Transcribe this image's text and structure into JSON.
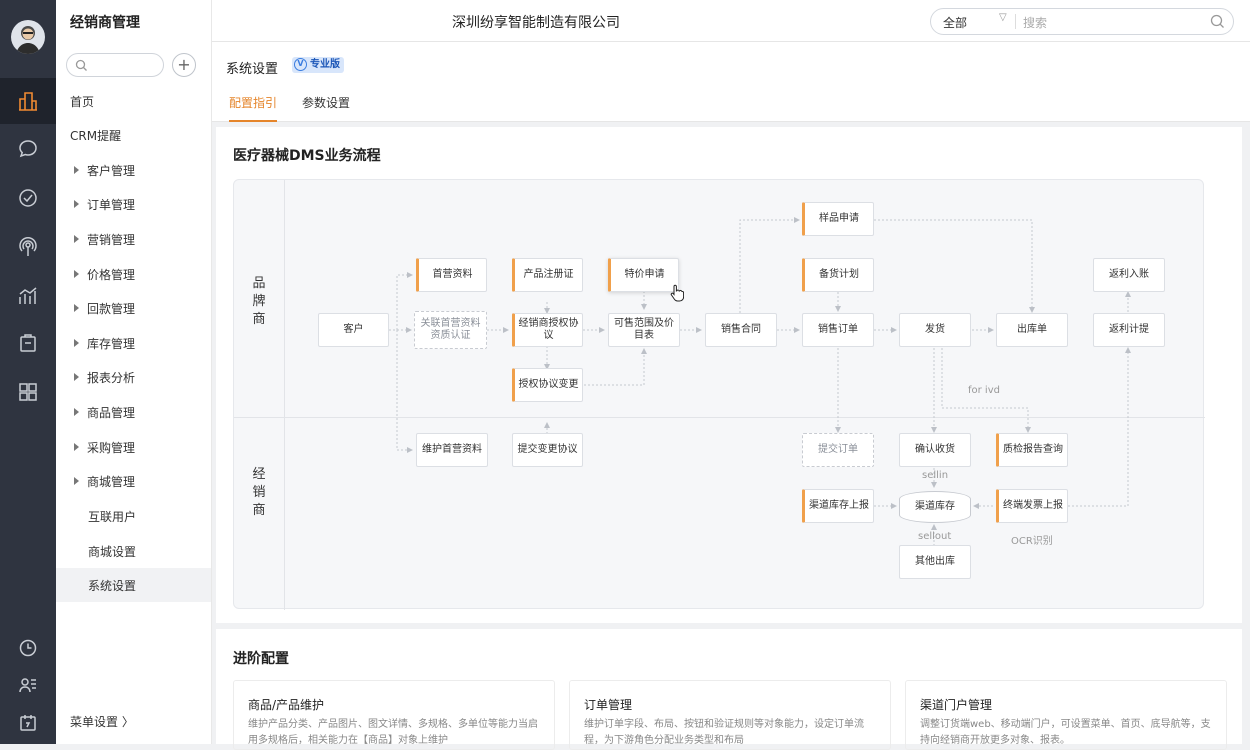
{
  "app": {
    "title": "经销商管理",
    "company": "深圳纷享智能制造有限公司"
  },
  "search": {
    "scope": "全部",
    "placeholder": "搜索"
  },
  "sidebar": {
    "items": [
      {
        "label": "首页",
        "expandable": false,
        "indent": false
      },
      {
        "label": "CRM提醒",
        "expandable": false,
        "indent": false
      },
      {
        "label": "客户管理",
        "expandable": true
      },
      {
        "label": "订单管理",
        "expandable": true
      },
      {
        "label": "营销管理",
        "expandable": true
      },
      {
        "label": "价格管理",
        "expandable": true
      },
      {
        "label": "回款管理",
        "expandable": true
      },
      {
        "label": "库存管理",
        "expandable": true
      },
      {
        "label": "报表分析",
        "expandable": true
      },
      {
        "label": "商品管理",
        "expandable": true
      },
      {
        "label": "采购管理",
        "expandable": true
      },
      {
        "label": "商城管理",
        "expandable": true
      },
      {
        "label": "互联用户",
        "expandable": false,
        "indent": true
      },
      {
        "label": "商城设置",
        "expandable": false,
        "indent": true
      },
      {
        "label": "系统设置",
        "expandable": false,
        "indent": true,
        "active": true
      }
    ],
    "footer": "菜单设置 〉"
  },
  "page": {
    "title": "系统设置",
    "badge": "专业版",
    "tabs": [
      "配置指引",
      "参数设置"
    ]
  },
  "flow": {
    "title": "医疗器械DMS业务流程",
    "lanes": [
      "品牌商",
      "经销商"
    ],
    "nodes": {
      "n_customer": "客户",
      "n_sgzl": "首营资料",
      "n_glsy": "关联首营资料资质认证",
      "n_cpzc": "产品注册证",
      "n_jxsxy": "经销商授权协议",
      "n_sqbg": "授权协议变更",
      "n_tjsq": "特价申请",
      "n_ksfw": "可售范围及价目表",
      "n_xsht": "销售合同",
      "n_ypsq": "样品申请",
      "n_bhjh": "备货计划",
      "n_xsdd": "销售订单",
      "n_fh": "发货",
      "n_ckd": "出库单",
      "n_flrz": "返利入账",
      "n_fljt": "返利计提",
      "n_whsy": "维护首营资料",
      "n_tjbg": "提交变更协议",
      "n_tjdd": "提交订单",
      "n_qrsh": "确认收货",
      "n_zjbg": "质检报告查询",
      "n_qdkcsb": "渠道库存上报",
      "n_qdkc": "渠道库存",
      "n_zdfp": "终端发票上报",
      "n_qtck": "其他出库"
    },
    "labels": {
      "forivd": "for ivd",
      "sellin": "sellin",
      "sellout": "sellout",
      "ocr": "OCR识别"
    }
  },
  "advanced": {
    "title": "进阶配置",
    "cards": [
      {
        "title": "商品/产品维护",
        "desc": "维护产品分类、产品图片、图文详情、多规格、多单位等能力当启用多规格后，相关能力在【商品】对象上维护"
      },
      {
        "title": "订单管理",
        "desc": "维护订单字段、布局、按钮和验证规则等对象能力，设定订单流程，为下游角色分配业务类型和布局"
      },
      {
        "title": "渠道门户管理",
        "desc": "调整订货端web、移动端门户，可设置菜单、首页、底导航等，支持向经销商开放更多对象、报表。"
      }
    ]
  },
  "colors": {
    "accent": "#e5852b",
    "rail": "#2f3440",
    "badge": "#d8e6fb"
  }
}
